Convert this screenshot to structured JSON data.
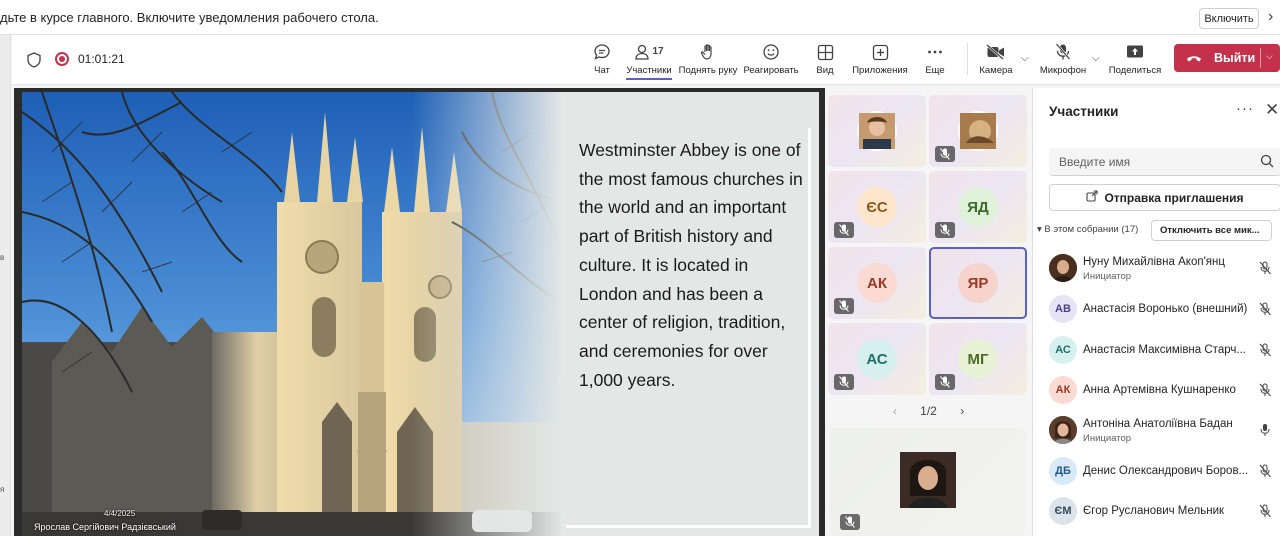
{
  "notification": {
    "text": "дьте в курсе главного. Включите уведомления рабочего стола.",
    "button": "Включить",
    "close_icon": "chevron-right-icon"
  },
  "left_strip": {
    "label_top": "в",
    "label_bottom": "я"
  },
  "toolbar": {
    "timer": "01:01:21",
    "chat": "Чат",
    "participants": "Участники",
    "participants_count": "17",
    "raise_hand": "Поднять руку",
    "react": "Реагировать",
    "view": "Вид",
    "apps": "Приложения",
    "more": "Еще",
    "camera": "Камера",
    "mic": "Микрофон",
    "share": "Поделиться",
    "leave": "Выйти",
    "accent_color": "#5b5fc7",
    "leave_color": "#c4314b"
  },
  "slide": {
    "text": "Westminster Abbey is one of the most famous churches in the world and an important part of British history and culture. It is located in London and has been a center of religion, tradition, and ceremonies for over 1,000 years.",
    "photo_date": "4/4/2025",
    "presenter": "Ярослав Сергійович Радзієвський"
  },
  "gallery": {
    "tiles": [
      {
        "initials": "",
        "type": "photo",
        "muted": false
      },
      {
        "initials": "",
        "type": "photo",
        "muted": true
      },
      {
        "initials": "ЄС",
        "muted": true,
        "bg": "#fde6cc",
        "fg": "#8a5a1c"
      },
      {
        "initials": "ЯД",
        "muted": true,
        "bg": "#dff2d9",
        "fg": "#3d6b2e"
      },
      {
        "initials": "АК",
        "muted": true,
        "bg": "#fbdad3",
        "fg": "#9a3a26"
      },
      {
        "initials": "ЯР",
        "muted": false,
        "bg": "#f7d3cd",
        "fg": "#9a3a26",
        "selected": true
      },
      {
        "initials": "АС",
        "muted": true,
        "bg": "#d6f0ee",
        "fg": "#1f6e6a"
      },
      {
        "initials": "МГ",
        "muted": true,
        "bg": "#e8f2d6",
        "fg": "#4f6b22"
      }
    ],
    "page": "1/2"
  },
  "panel": {
    "title": "Участники",
    "search_placeholder": "Введите имя",
    "invite": "Отправка приглашения",
    "section": "В этом собрании (17)",
    "mute_all": "Отключить все мик...",
    "participants": [
      {
        "name": "Нуну Михайлівна Акоп'янц",
        "role": "Инициатор",
        "initials": "",
        "photo": true,
        "mic": "muted"
      },
      {
        "name": "Анастасія Воронько (внешний)",
        "role": "",
        "initials": "АВ",
        "bg": "#e6e3f5",
        "fg": "#4a3f8a",
        "mic": "muted"
      },
      {
        "name": "Анастасія Максимівна Старч...",
        "role": "",
        "initials": "АС",
        "bg": "#d6f0ee",
        "fg": "#1f6e6a",
        "mic": "muted"
      },
      {
        "name": "Анна Артемівна Кушнаренко",
        "role": "",
        "initials": "АК",
        "bg": "#fbdad3",
        "fg": "#9a3a26",
        "mic": "muted"
      },
      {
        "name": "Антоніна Анатоліївна Бадан",
        "role": "Инициатор",
        "initials": "",
        "photo": true,
        "mic": "on"
      },
      {
        "name": "Денис Олександрович Боров...",
        "role": "",
        "initials": "ДБ",
        "bg": "#d9e9f7",
        "fg": "#245a8a",
        "mic": "muted"
      },
      {
        "name": "Єгор Русланович Мельник",
        "role": "",
        "initials": "ЄМ",
        "bg": "#dbe4ea",
        "fg": "#33495a",
        "mic": "muted"
      }
    ]
  }
}
